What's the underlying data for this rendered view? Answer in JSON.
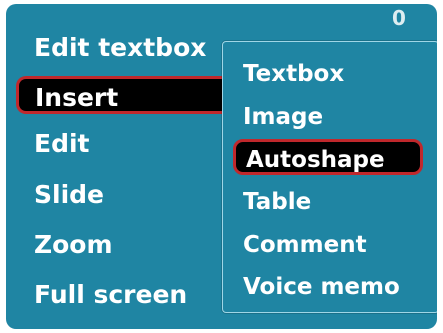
{
  "status_mark": "0",
  "main_menu": {
    "items": [
      {
        "label": "Edit textbox"
      },
      {
        "label": "Insert"
      },
      {
        "label": "Edit"
      },
      {
        "label": "Slide"
      },
      {
        "label": "Zoom"
      },
      {
        "label": "Full screen"
      }
    ],
    "selected": "Insert"
  },
  "submenu": {
    "items": [
      {
        "label": "Textbox"
      },
      {
        "label": "Image"
      },
      {
        "label": "Autoshape"
      },
      {
        "label": "Table"
      },
      {
        "label": "Comment"
      },
      {
        "label": "Voice memo"
      }
    ],
    "selected": "Autoshape"
  },
  "colors": {
    "background": "#1f85a3",
    "highlight": "#000000",
    "highlight_border": "#c0282c",
    "text": "#ffffff"
  }
}
